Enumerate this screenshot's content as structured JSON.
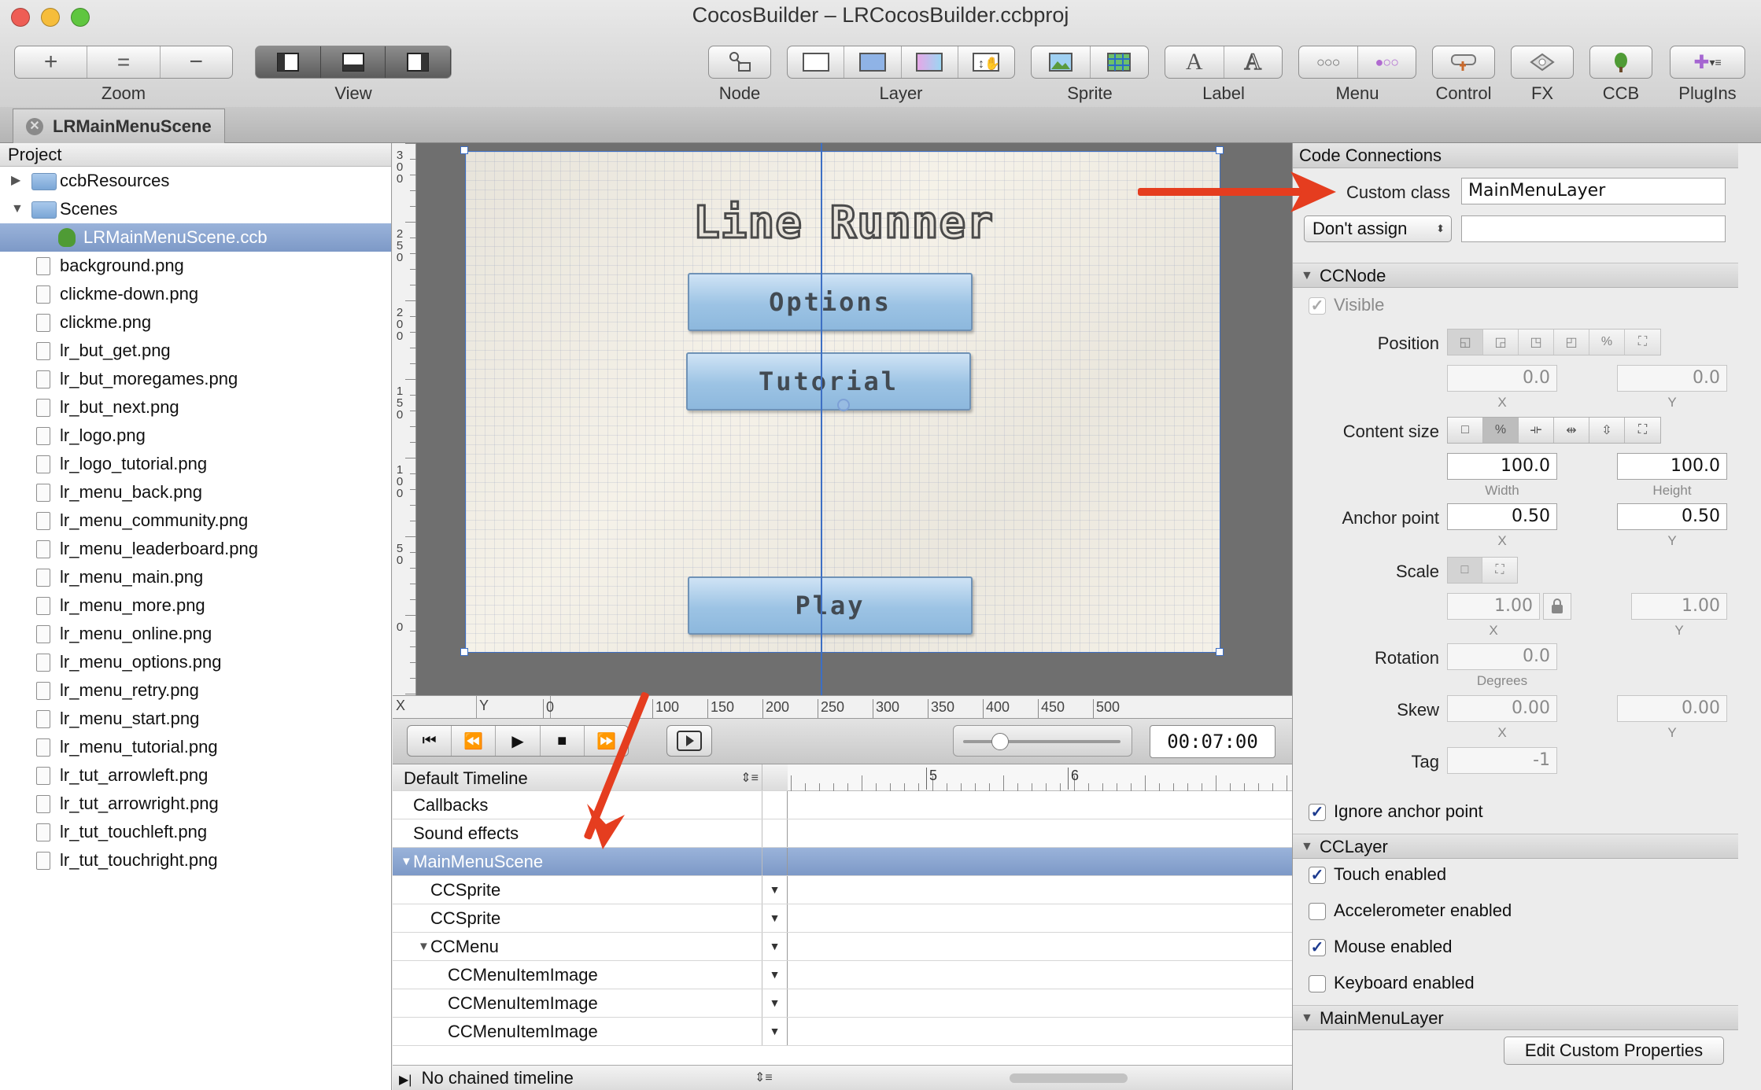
{
  "window": {
    "title": "CocosBuilder – LRCocosBuilder.ccbproj"
  },
  "toolbar": {
    "zoom_label": "Zoom",
    "view_label": "View",
    "node_label": "Node",
    "layer_label": "Layer",
    "sprite_label": "Sprite",
    "label_label": "Label",
    "menu_label": "Menu",
    "control_label": "Control",
    "fx_label": "FX",
    "ccb_label": "CCB",
    "plugins_label": "PlugIns"
  },
  "doc_tab": {
    "label": "LRMainMenuScene"
  },
  "project": {
    "header": "Project",
    "items": [
      {
        "name": "ccbResources",
        "kind": "folder",
        "disclosure": "▶"
      },
      {
        "name": "Scenes",
        "kind": "folder",
        "disclosure": "▼"
      },
      {
        "name": "LRMainMenuScene.ccb",
        "kind": "ccb",
        "selected": true
      },
      {
        "name": "background.png",
        "kind": "file"
      },
      {
        "name": "clickme-down.png",
        "kind": "file"
      },
      {
        "name": "clickme.png",
        "kind": "file"
      },
      {
        "name": "lr_but_get.png",
        "kind": "file"
      },
      {
        "name": "lr_but_moregames.png",
        "kind": "file"
      },
      {
        "name": "lr_but_next.png",
        "kind": "file"
      },
      {
        "name": "lr_logo.png",
        "kind": "file"
      },
      {
        "name": "lr_logo_tutorial.png",
        "kind": "file"
      },
      {
        "name": "lr_menu_back.png",
        "kind": "file"
      },
      {
        "name": "lr_menu_community.png",
        "kind": "file"
      },
      {
        "name": "lr_menu_leaderboard.png",
        "kind": "file"
      },
      {
        "name": "lr_menu_main.png",
        "kind": "file"
      },
      {
        "name": "lr_menu_more.png",
        "kind": "file"
      },
      {
        "name": "lr_menu_online.png",
        "kind": "file"
      },
      {
        "name": "lr_menu_options.png",
        "kind": "file"
      },
      {
        "name": "lr_menu_retry.png",
        "kind": "file"
      },
      {
        "name": "lr_menu_start.png",
        "kind": "file"
      },
      {
        "name": "lr_menu_tutorial.png",
        "kind": "file"
      },
      {
        "name": "lr_tut_arrowleft.png",
        "kind": "file"
      },
      {
        "name": "lr_tut_arrowright.png",
        "kind": "file"
      },
      {
        "name": "lr_tut_touchleft.png",
        "kind": "file"
      },
      {
        "name": "lr_tut_touchright.png",
        "kind": "file"
      }
    ]
  },
  "canvas": {
    "logo_text": "Line Runner",
    "buttons": {
      "options": "Options",
      "tutorial": "Tutorial",
      "play": "Play"
    },
    "vruler_ticks": [
      "300",
      "250",
      "200",
      "150",
      "100",
      "50",
      "0"
    ],
    "hruler": {
      "x_label": "X",
      "y_label": "Y",
      "ticks": [
        "0",
        "100",
        "150",
        "200",
        "250",
        "300",
        "350",
        "400",
        "450",
        "500"
      ]
    }
  },
  "transport": {
    "time": "00:07:00"
  },
  "timeline": {
    "header": "Default Timeline",
    "ruler_ticks": [
      "5",
      "6"
    ],
    "rows": [
      {
        "label": "Callbacks",
        "indent": 0,
        "selected": false,
        "dropdown": false,
        "disclosure": ""
      },
      {
        "label": "Sound effects",
        "indent": 0,
        "selected": false,
        "dropdown": false,
        "disclosure": ""
      },
      {
        "label": "MainMenuScene",
        "indent": 0,
        "selected": true,
        "dropdown": false,
        "disclosure": "▼"
      },
      {
        "label": "CCSprite",
        "indent": 1,
        "selected": false,
        "dropdown": true,
        "disclosure": ""
      },
      {
        "label": "CCSprite",
        "indent": 1,
        "selected": false,
        "dropdown": true,
        "disclosure": ""
      },
      {
        "label": "CCMenu",
        "indent": 1,
        "selected": false,
        "dropdown": true,
        "disclosure": "▼"
      },
      {
        "label": "CCMenuItemImage",
        "indent": 2,
        "selected": false,
        "dropdown": true,
        "disclosure": ""
      },
      {
        "label": "CCMenuItemImage",
        "indent": 2,
        "selected": false,
        "dropdown": true,
        "disclosure": ""
      },
      {
        "label": "CCMenuItemImage",
        "indent": 2,
        "selected": false,
        "dropdown": true,
        "disclosure": ""
      }
    ],
    "footer": "No chained timeline"
  },
  "inspector": {
    "code_connections": {
      "header": "Code Connections",
      "custom_class_label": "Custom class",
      "custom_class_value": "MainMenuLayer",
      "assign_value": "Don't assign",
      "assign_field": ""
    },
    "ccnode": {
      "header": "CCNode",
      "visible_label": "Visible",
      "visible": true,
      "position_label": "Position",
      "position_x": "0.0",
      "position_y": "0.0",
      "x_label": "X",
      "y_label": "Y",
      "content_size_label": "Content size",
      "width": "100.0",
      "height": "100.0",
      "width_label": "Width",
      "height_label": "Height",
      "anchor_label": "Anchor point",
      "anchor_x": "0.50",
      "anchor_y": "0.50",
      "scale_label": "Scale",
      "scale_x": "1.00",
      "scale_y": "1.00",
      "rotation_label": "Rotation",
      "rotation": "0.0",
      "degrees_label": "Degrees",
      "skew_label": "Skew",
      "skew_x": "0.00",
      "skew_y": "0.00",
      "tag_label": "Tag",
      "tag": "-1",
      "ignore_anchor_label": "Ignore anchor point",
      "ignore_anchor": true
    },
    "cclayer": {
      "header": "CCLayer",
      "touch_label": "Touch enabled",
      "touch": true,
      "accel_label": "Accelerometer enabled",
      "accel": false,
      "mouse_label": "Mouse enabled",
      "mouse": true,
      "keyboard_label": "Keyboard enabled",
      "keyboard": false
    },
    "mainmenulayer": {
      "header": "MainMenuLayer",
      "edit_button": "Edit Custom Properties"
    }
  },
  "colors": {
    "selection": "#7d99c7",
    "annotation_arrow": "#e53d1f",
    "guide_line": "#3d6fc4"
  }
}
